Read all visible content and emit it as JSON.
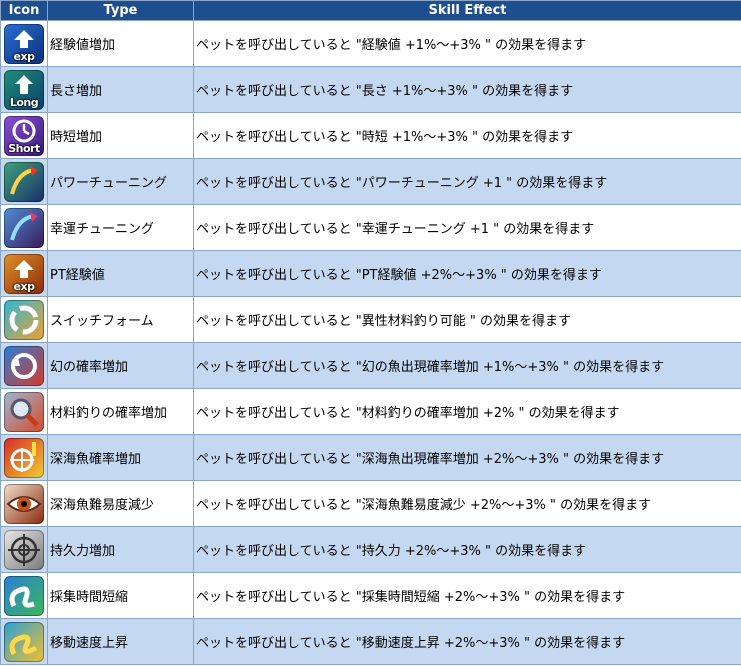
{
  "headers": {
    "icon": "Icon",
    "type": "Type",
    "effect": "Skill Effect"
  },
  "rows": [
    {
      "type": "経験値増加",
      "effect": "ペットを呼び出していると \"経験値 +1%～+3% \" の効果を得ます",
      "icon": "exp-icon",
      "icon_label": "exp",
      "colors": [
        "#2a6fd6",
        "#0b2f7a"
      ]
    },
    {
      "type": "長さ増加",
      "effect": "ペットを呼び出していると \"長さ +1%～+3% \" の効果を得ます",
      "icon": "long-icon",
      "icon_label": "Long",
      "colors": [
        "#1e8f7a",
        "#0d3f6a"
      ]
    },
    {
      "type": "時短増加",
      "effect": "ペットを呼び出していると \"時短 +1%～+3% \" の効果を得ます",
      "icon": "short-icon",
      "icon_label": "Short",
      "colors": [
        "#8a4fd6",
        "#3a1a7a"
      ]
    },
    {
      "type": "パワーチューニング",
      "effect": "ペットを呼び出していると \"パワーチューニング +1 \" の効果を得ます",
      "icon": "power-tuning-icon",
      "icon_label": "",
      "colors": [
        "#3fa37a",
        "#1a2f6a"
      ]
    },
    {
      "type": "幸運チューニング",
      "effect": "ペットを呼び出していると \"幸運チューニング +1 \" の効果を得ます",
      "icon": "luck-tuning-icon",
      "icon_label": "",
      "colors": [
        "#4f8fd6",
        "#3a1a5a"
      ]
    },
    {
      "type": "PT経験値",
      "effect": "ペットを呼び出していると \"PT経験値 +2%～+3% \" の効果を得ます",
      "icon": "pt-exp-icon",
      "icon_label": "exp",
      "colors": [
        "#e0902a",
        "#8a2a0a"
      ]
    },
    {
      "type": "スイッチフォーム",
      "effect": "ペットを呼び出していると \"異性材料釣り可能 \" の効果を得ます",
      "icon": "switch-form-icon",
      "icon_label": "",
      "colors": [
        "#2ab8d6",
        "#f0a030"
      ]
    },
    {
      "type": "幻の確率増加",
      "effect": "ペットを呼び出していると \"幻の魚出現確率増加 +1%～+3% \" の効果を得ます",
      "icon": "phantom-icon",
      "icon_label": "",
      "colors": [
        "#2a7fd6",
        "#d63a2a"
      ]
    },
    {
      "type": "材料釣りの確率増加",
      "effect": "ペットを呼び出していると \"材料釣りの確率増加 +2% \" の効果を得ます",
      "icon": "material-icon",
      "icon_label": "",
      "colors": [
        "#9ab8d6",
        "#d64a2a"
      ]
    },
    {
      "type": "深海魚確率増加",
      "effect": "ペットを呼び出していると \"深海魚出現確率増加 +2%～+3% \" の効果を得ます",
      "icon": "deep-sea-icon",
      "icon_label": "",
      "colors": [
        "#d62a2a",
        "#f0d030"
      ]
    },
    {
      "type": "深海魚難易度減少",
      "effect": "ペットを呼び出していると \"深海魚難易度減少 +2%～+3% \" の効果を得ます",
      "icon": "eye-icon",
      "icon_label": "",
      "colors": [
        "#f0e0d0",
        "#8a2a0a"
      ]
    },
    {
      "type": "持久力増加",
      "effect": "ペットを呼び出していると \"持久力 +2%～+3% \" の効果を得ます",
      "icon": "crosshair-icon",
      "icon_label": "",
      "colors": [
        "#e8e8e8",
        "#7a7a7a"
      ]
    },
    {
      "type": "採集時間短縮",
      "effect": "ペットを呼び出していると \"採集時間短縮 +2%～+3% \" の効果を得ます",
      "icon": "gather-icon",
      "icon_label": "",
      "colors": [
        "#2a7fd6",
        "#3ab85a"
      ]
    },
    {
      "type": "移動速度上昇",
      "effect": "ペットを呼び出していると \"移動速度上昇 +2%～+3% \" の効果を得ます",
      "icon": "speed-icon",
      "icon_label": "",
      "colors": [
        "#2a9fd6",
        "#f0c030"
      ]
    }
  ]
}
